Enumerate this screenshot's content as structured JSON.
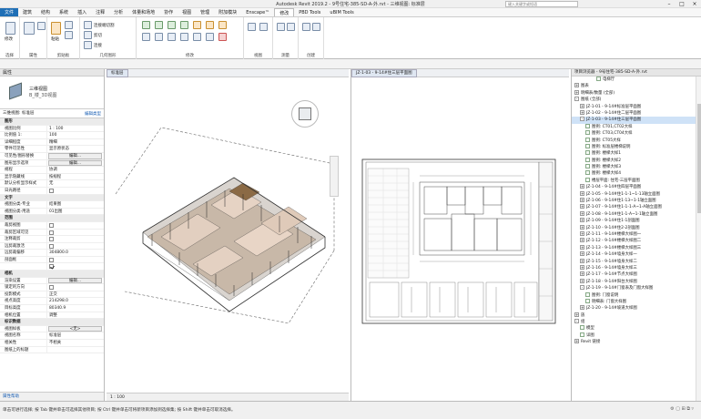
{
  "titlebar": {
    "title": "Autodesk Revit 2019.2 - 9号住宅-385-SD-A-外.rvt - 三维视图: 标准层",
    "search_placeholder": "键入关键字或短语"
  },
  "tabs": [
    {
      "label": "文件",
      "type": "file"
    },
    {
      "label": "建筑"
    },
    {
      "label": "结构"
    },
    {
      "label": "系统"
    },
    {
      "label": "插入"
    },
    {
      "label": "注释"
    },
    {
      "label": "分析"
    },
    {
      "label": "体量和场地"
    },
    {
      "label": "协作"
    },
    {
      "label": "视图"
    },
    {
      "label": "管理"
    },
    {
      "label": "附加模块"
    },
    {
      "label": "Enscape™"
    },
    {
      "label": "修改",
      "active": true
    },
    {
      "label": "PBD Tools"
    },
    {
      "label": "uBIM Tools"
    }
  ],
  "ribbon": {
    "groups": [
      "选择",
      "属性",
      "剪贴板",
      "几何图形",
      "修改",
      "视图",
      "测量",
      "创建"
    ],
    "labels": {
      "modify": "修改",
      "paste": "粘贴",
      "connect": "连接",
      "cut": "剪切",
      "join": "连接"
    },
    "cope": "连接端切割",
    "join_geom": "连接",
    "cut_geom": "剪切"
  },
  "properties": {
    "header": "属性",
    "type_name_1": "三维视图",
    "type_name_2": "B_楼_3D视图",
    "filter_label": "三维视图: 标准层",
    "edit_type": "编辑类型",
    "rows": [
      {
        "k": "图形",
        "sec": true
      },
      {
        "k": "视图比例",
        "v": "1 : 100"
      },
      {
        "k": "比例值 1:",
        "v": "100"
      },
      {
        "k": "详细程度",
        "v": "精细"
      },
      {
        "k": "零件可见性",
        "v": "显示原状态"
      },
      {
        "k": "可见性/图形替换",
        "v": "编辑...",
        "btn": true
      },
      {
        "k": "图形显示选项",
        "v": "编辑...",
        "btn": true
      },
      {
        "k": "规程",
        "v": "协调"
      },
      {
        "k": "显示隐藏线",
        "v": "按规程"
      },
      {
        "k": "默认分析显示样式",
        "v": "无"
      },
      {
        "k": "日光路径",
        "chk": false
      },
      {
        "k": "文字",
        "sec": true
      },
      {
        "k": "视图分类-专业",
        "v": "结果图"
      },
      {
        "k": "视图分类-用途",
        "v": "01出图"
      },
      {
        "k": "范围",
        "sec": true
      },
      {
        "k": "裁剪视图",
        "chk": false
      },
      {
        "k": "裁剪区域可见",
        "chk": false
      },
      {
        "k": "注释裁剪",
        "chk": false
      },
      {
        "k": "远剪裁激活",
        "chk": false
      },
      {
        "k": "远剪裁偏移",
        "v": "304800.0"
      },
      {
        "k": "剖面框",
        "chk": false
      },
      {
        "k": "",
        "chk": true
      },
      {
        "k": "相机",
        "sec": true
      },
      {
        "k": "渲染设置",
        "v": "编辑...",
        "btn": true
      },
      {
        "k": "锁定的方向",
        "chk": false
      },
      {
        "k": "投影模式",
        "v": "正交"
      },
      {
        "k": "视点高度",
        "v": "214298.0"
      },
      {
        "k": "目标高度",
        "v": "80340.9"
      },
      {
        "k": "相机位置",
        "v": "调整"
      },
      {
        "k": "标识数据",
        "sec": true
      },
      {
        "k": "视图样板",
        "v": "<无>",
        "btn": true
      },
      {
        "k": "视图名称",
        "v": "标准层"
      },
      {
        "k": "相关性",
        "v": "不相关"
      },
      {
        "k": "图纸上的标题",
        "v": ""
      }
    ],
    "footer": "属性帮助",
    "apply": "应用"
  },
  "views": {
    "tab3d": "标准层",
    "tabsheet": "JZ-1-03 - 9-14#住三层平面图",
    "footer3d": "1 : 100",
    "chart_labels": [
      "门窗表"
    ]
  },
  "browser": {
    "header": "项目浏览器 - 9号住宅-385-SD-A-外.rvt",
    "items": [
      {
        "t": "电梯厅",
        "lvl": 4
      },
      {
        "t": "图表",
        "lvl": 0,
        "tg": "+"
      },
      {
        "t": "明细表/数量 (全部)",
        "lvl": 0,
        "tg": "+"
      },
      {
        "t": "图纸 (全部)",
        "lvl": 0,
        "tg": "-"
      },
      {
        "t": "JZ-1-01 - 9-14#标准层平面图",
        "lvl": 1,
        "tg": "+"
      },
      {
        "t": "JZ-1-02 - 9-14#住二层平面图",
        "lvl": 1,
        "tg": "+"
      },
      {
        "t": "JZ-1-03 - 9-14#住三层平面图",
        "lvl": 1,
        "tg": "-",
        "sel": true
      },
      {
        "t": "图例: CT01,CT02大样",
        "lvl": 2
      },
      {
        "t": "图例: CT03,CT04大样",
        "lvl": 2
      },
      {
        "t": "图例: CT05大样",
        "lvl": 2
      },
      {
        "t": "图例: 标准层楼梯说明",
        "lvl": 2
      },
      {
        "t": "图例: 楼梯大样1",
        "lvl": 2
      },
      {
        "t": "图例: 楼梯大样2",
        "lvl": 2
      },
      {
        "t": "图例: 楼梯大样3",
        "lvl": 2
      },
      {
        "t": "图例: 楼梯大样4",
        "lvl": 2
      },
      {
        "t": "楼层平面: 住宅-三层平面图",
        "lvl": 2
      },
      {
        "t": "JZ-1-04 - 9-14#住四层平面图",
        "lvl": 1,
        "tg": "+"
      },
      {
        "t": "JZ-1-05 - 9-14#住1-1-1~1-13轴立面图",
        "lvl": 1,
        "tg": "+"
      },
      {
        "t": "JZ-1-06 - 9-14#住1-13~1-1轴立面图",
        "lvl": 1,
        "tg": "+"
      },
      {
        "t": "JZ-1-07 - 9-14#住1-1-1-A~1-A轴立面图",
        "lvl": 1,
        "tg": "+"
      },
      {
        "t": "JZ-1-08 - 9-14#住1-1-A~1-1轴立面图",
        "lvl": 1,
        "tg": "+"
      },
      {
        "t": "JZ-1-09 - 9-14#住1-1剖面图",
        "lvl": 1,
        "tg": "+"
      },
      {
        "t": "JZ-1-10 - 9-14#住2-2剖面图",
        "lvl": 1,
        "tg": "+"
      },
      {
        "t": "JZ-1-11 - 9-14#楼梯大样图一",
        "lvl": 1,
        "tg": "+"
      },
      {
        "t": "JZ-1-12 - 9-14#楼梯大样图二",
        "lvl": 1,
        "tg": "+"
      },
      {
        "t": "JZ-1-13 - 9-14#楼梯大样图三",
        "lvl": 1,
        "tg": "+"
      },
      {
        "t": "JZ-1-14 - 9-14#墙身大样一",
        "lvl": 1,
        "tg": "+"
      },
      {
        "t": "JZ-1-15 - 9-14#墙身大样二",
        "lvl": 1,
        "tg": "+"
      },
      {
        "t": "JZ-1-16 - 9-14#墙身大样三",
        "lvl": 1,
        "tg": "+"
      },
      {
        "t": "JZ-1-17 - 9-14#节点大样图",
        "lvl": 1,
        "tg": "+"
      },
      {
        "t": "JZ-1-18 - 9-14#阳台大样图",
        "lvl": 1,
        "tg": "+"
      },
      {
        "t": "JZ-1-19 - 9-14#门窗表及门窗大样图",
        "lvl": 1,
        "tg": "-"
      },
      {
        "t": "图例: 门窗说明",
        "lvl": 2
      },
      {
        "t": "明细表: 门窗大样图",
        "lvl": 2
      },
      {
        "t": "JZ-1-20 - 9-14#坡道大样图",
        "lvl": 1,
        "tg": "+"
      },
      {
        "t": "族",
        "lvl": 0,
        "tg": "+"
      },
      {
        "t": "组",
        "lvl": 0,
        "tg": "-"
      },
      {
        "t": "模型",
        "lvl": 1
      },
      {
        "t": "详图",
        "lvl": 1
      },
      {
        "t": "Revit 链接",
        "lvl": 0,
        "tg": "+"
      }
    ]
  },
  "status": {
    "text": "单击可进行选择; 按 Tab 键并单击可选择其他项目; 按 Ctrl 键并单击可将新项目添加到选择集; 按 Shift 键并单击可取消选择。"
  }
}
